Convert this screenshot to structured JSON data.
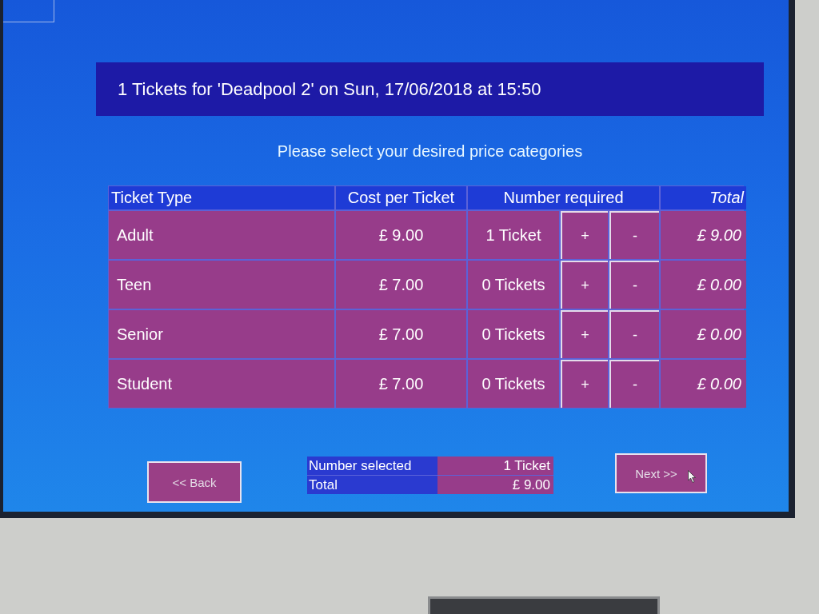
{
  "title_bar": {
    "title": "1 Tickets for 'Deadpool 2' on Sun, 17/06/2018 at 15:50"
  },
  "instruction": "Please select your desired price categories",
  "table": {
    "columns": [
      "Ticket Type",
      "Cost per Ticket",
      "Number required",
      "Total"
    ],
    "rows": [
      {
        "ticket_type": "Adult",
        "cost": "£ 9.00",
        "number": "1 Ticket",
        "plus": "+",
        "minus": "-",
        "total": "£ 9.00"
      },
      {
        "ticket_type": "Teen",
        "cost": "£ 7.00",
        "number": "0 Tickets",
        "plus": "+",
        "minus": "-",
        "total": "£ 0.00"
      },
      {
        "ticket_type": "Senior",
        "cost": "£ 7.00",
        "number": "0 Tickets",
        "plus": "+",
        "minus": "-",
        "total": "£ 0.00"
      },
      {
        "ticket_type": "Student",
        "cost": "£ 7.00",
        "number": "0 Tickets",
        "plus": "+",
        "minus": "-",
        "total": "£ 0.00"
      }
    ]
  },
  "footer": {
    "back_button": "<< Back",
    "summary": [
      {
        "label": "Number selected",
        "value": "1 Ticket"
      },
      {
        "label": "Total",
        "value": "£ 9.00"
      }
    ],
    "next_button": "Next >>"
  }
}
